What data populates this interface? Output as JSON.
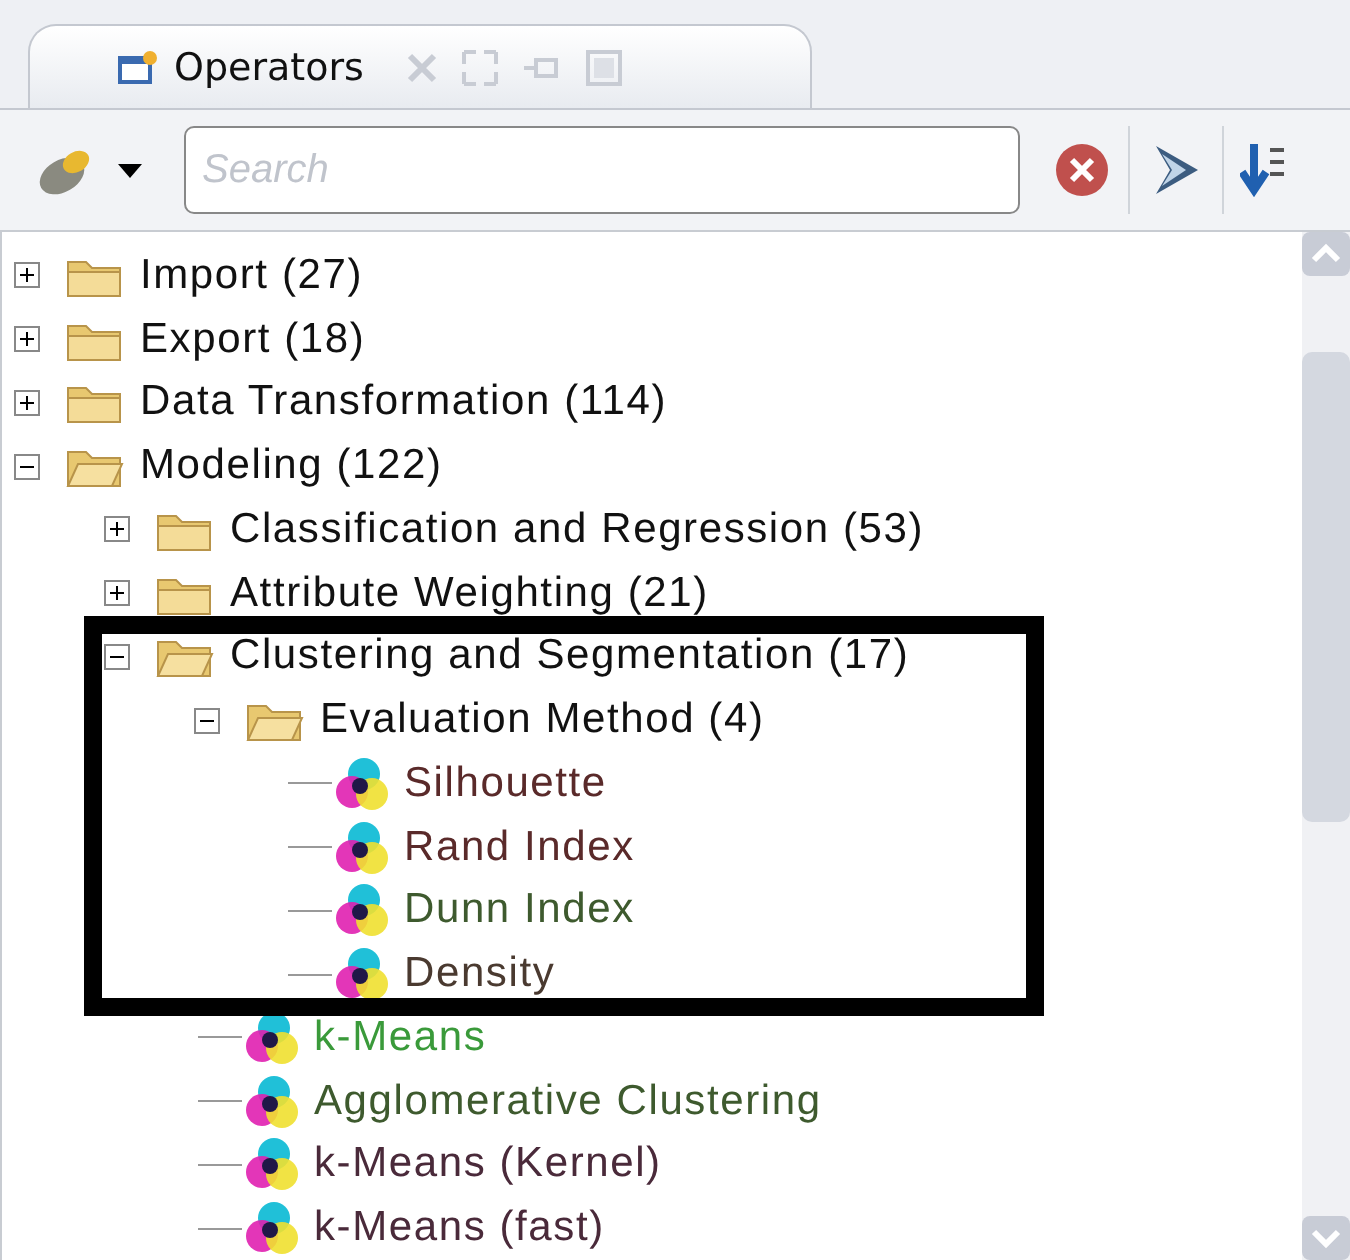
{
  "tab": {
    "label": "Operators",
    "selected": true
  },
  "search": {
    "placeholder": "Search"
  },
  "tree": [
    {
      "kind": "folder",
      "label": "Import (27)",
      "expanded": false
    },
    {
      "kind": "folder",
      "label": "Export (18)",
      "expanded": false
    },
    {
      "kind": "folder",
      "label": "Data Transformation (114)",
      "expanded": false
    },
    {
      "kind": "folder",
      "label": "Modeling (122)",
      "expanded": true,
      "children": [
        {
          "kind": "folder",
          "label": "Classification and Regression (53)",
          "expanded": false
        },
        {
          "kind": "folder",
          "label": "Attribute Weighting (21)",
          "expanded": false
        },
        {
          "kind": "folder",
          "label": "Clustering and Segmentation (17)",
          "expanded": true,
          "children": [
            {
              "kind": "folder",
              "label": "Evaluation Method (4)",
              "expanded": true,
              "children": [
                {
                  "kind": "operator",
                  "label": "Silhouette",
                  "color": "#5a2a2a"
                },
                {
                  "kind": "operator",
                  "label": "Rand Index",
                  "color": "#5a2a2a"
                },
                {
                  "kind": "operator",
                  "label": "Dunn Index",
                  "color": "#3e5a2e"
                },
                {
                  "kind": "operator",
                  "label": "Density",
                  "color": "#4a3a30"
                }
              ]
            },
            {
              "kind": "operator",
              "label": "k-Means",
              "color": "#3a9a3a"
            },
            {
              "kind": "operator",
              "label": "Agglomerative Clustering",
              "color": "#3e5a2e"
            },
            {
              "kind": "operator",
              "label": "k-Means (Kernel)",
              "color": "#4a2a3a"
            },
            {
              "kind": "operator",
              "label": "k-Means (fast)",
              "color": "#4a2a3a"
            }
          ]
        }
      ]
    }
  ]
}
